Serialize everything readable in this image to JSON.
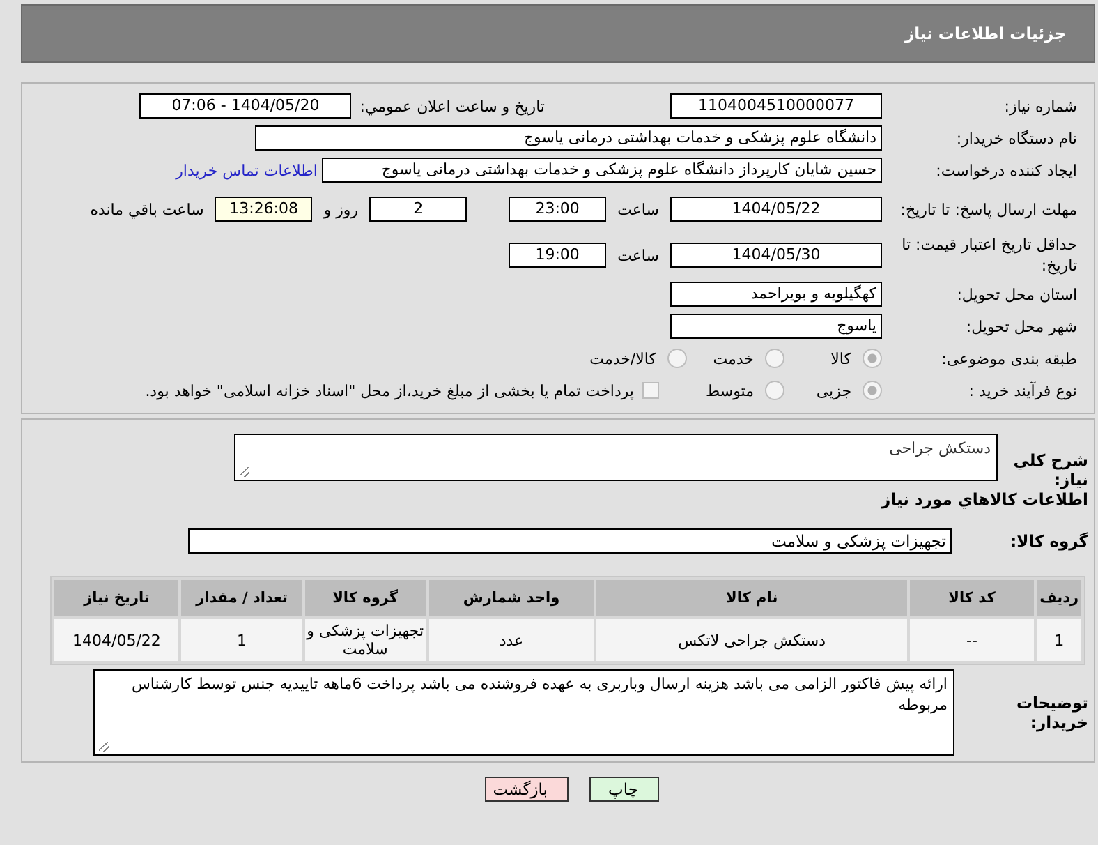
{
  "header": {
    "title": "جزئیات اطلاعات نیاز"
  },
  "need_number": {
    "label": "شماره نیاز:",
    "value": "1104004510000077"
  },
  "announce": {
    "label": "تاریخ و ساعت اعلان عمومي:",
    "value": "1404/05/20 - 07:06"
  },
  "buyer_org": {
    "label": "نام دستگاه خریدار:",
    "value": "دانشگاه علوم پزشکی و خدمات بهداشتی  درمانی یاسوج"
  },
  "requester": {
    "label": "ایجاد کننده درخواست:",
    "value": "حسین شایان کارپرداز دانشگاه علوم پزشکی و خدمات بهداشتی  درمانی یاسوج",
    "link": "اطلاعات تماس خریدار"
  },
  "reply_deadline": {
    "label": "مهلت ارسال پاسخ: تا تاریخ:",
    "date": "1404/05/22",
    "time_label": "ساعت",
    "time": "23:00",
    "days": "2",
    "days_label": "روز و",
    "remaining": "13:26:08",
    "remaining_label": "ساعت باقي مانده"
  },
  "price_validity": {
    "label": "حداقل تاریخ اعتبار قیمت: تا تاریخ:",
    "date": "1404/05/30",
    "time_label": "ساعت",
    "time": "19:00"
  },
  "province": {
    "label": "استان محل تحویل:",
    "value": "کهگیلویه و بویراحمد"
  },
  "city": {
    "label": "شهر محل تحویل:",
    "value": "یاسوج"
  },
  "category": {
    "label": "طبقه بندی موضوعی:",
    "options": [
      {
        "label": "کالا",
        "selected": true
      },
      {
        "label": "خدمت",
        "selected": false
      },
      {
        "label": "کالا/خدمت",
        "selected": false
      }
    ]
  },
  "purchase_type": {
    "label": "نوع فرآیند خرید :",
    "options": [
      {
        "label": "جزیی",
        "selected": true
      },
      {
        "label": "متوسط",
        "selected": false
      }
    ],
    "treasury": {
      "checked": false,
      "label": "پرداخت تمام یا بخشی از مبلغ خرید،از محل \"اسناد خزانه اسلامی\" خواهد بود."
    }
  },
  "description": {
    "label": "شرح کلي نیاز:",
    "value": "دستکش جراحی"
  },
  "goods_heading": "اطلاعات کالاهاي مورد نیاز",
  "goods_group": {
    "label": "گروه کالا:",
    "value": "تجهیزات پزشکی و سلامت"
  },
  "table": {
    "columns": [
      "ردیف",
      "کد کالا",
      "نام کالا",
      "واحد شمارش",
      "گروه کالا",
      "تعداد / مقدار",
      "تاریخ نیاز"
    ],
    "rows": [
      [
        "1",
        "--",
        "دستکش جراحی لاتکس",
        "عدد",
        "تجهیزات پزشکی و سلامت",
        "1",
        "1404/05/22"
      ]
    ]
  },
  "buyer_notes": {
    "label": "توضیحات خریدار:",
    "value": "ارائه پیش فاکتور الزامی می باشد هزینه ارسال وباربری به عهده فروشنده می باشد پرداخت 6ماهه تاییدیه جنس توسط کارشناس مربوطه"
  },
  "buttons": [
    {
      "kind": "print",
      "label": "چاپ"
    },
    {
      "kind": "back",
      "label": "بازگشت"
    }
  ]
}
